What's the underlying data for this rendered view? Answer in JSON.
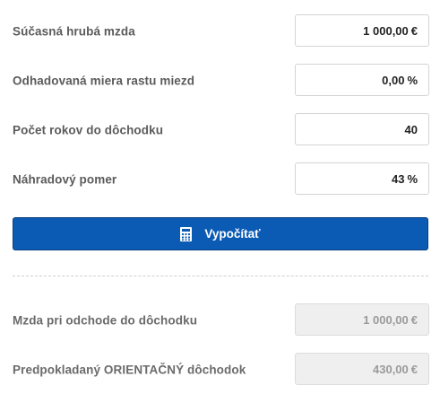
{
  "inputs": {
    "current_salary": {
      "label": "Súčasná hrubá mzda",
      "value": "1 000,00",
      "unit": "€"
    },
    "growth_rate": {
      "label": "Odhadovaná miera rastu miezd",
      "value": "0,00",
      "unit": "%"
    },
    "years": {
      "label": "Počet rokov do dôchodku",
      "value": "40",
      "unit": ""
    },
    "replacement": {
      "label": "Náhradový pomer",
      "value": "43",
      "unit": "%"
    }
  },
  "button": {
    "label": "Vypočítať",
    "icon": "calculator-icon",
    "color": "#0b5bb5"
  },
  "results": {
    "salary_at_retirement": {
      "label": "Mzda pri odchode do dôchodku",
      "value": "1 000,00",
      "unit": "€"
    },
    "estimated_pension": {
      "label": "Predpokladaný ORIENTAČNÝ dôchodok",
      "value": "430,00",
      "unit": "€"
    }
  }
}
